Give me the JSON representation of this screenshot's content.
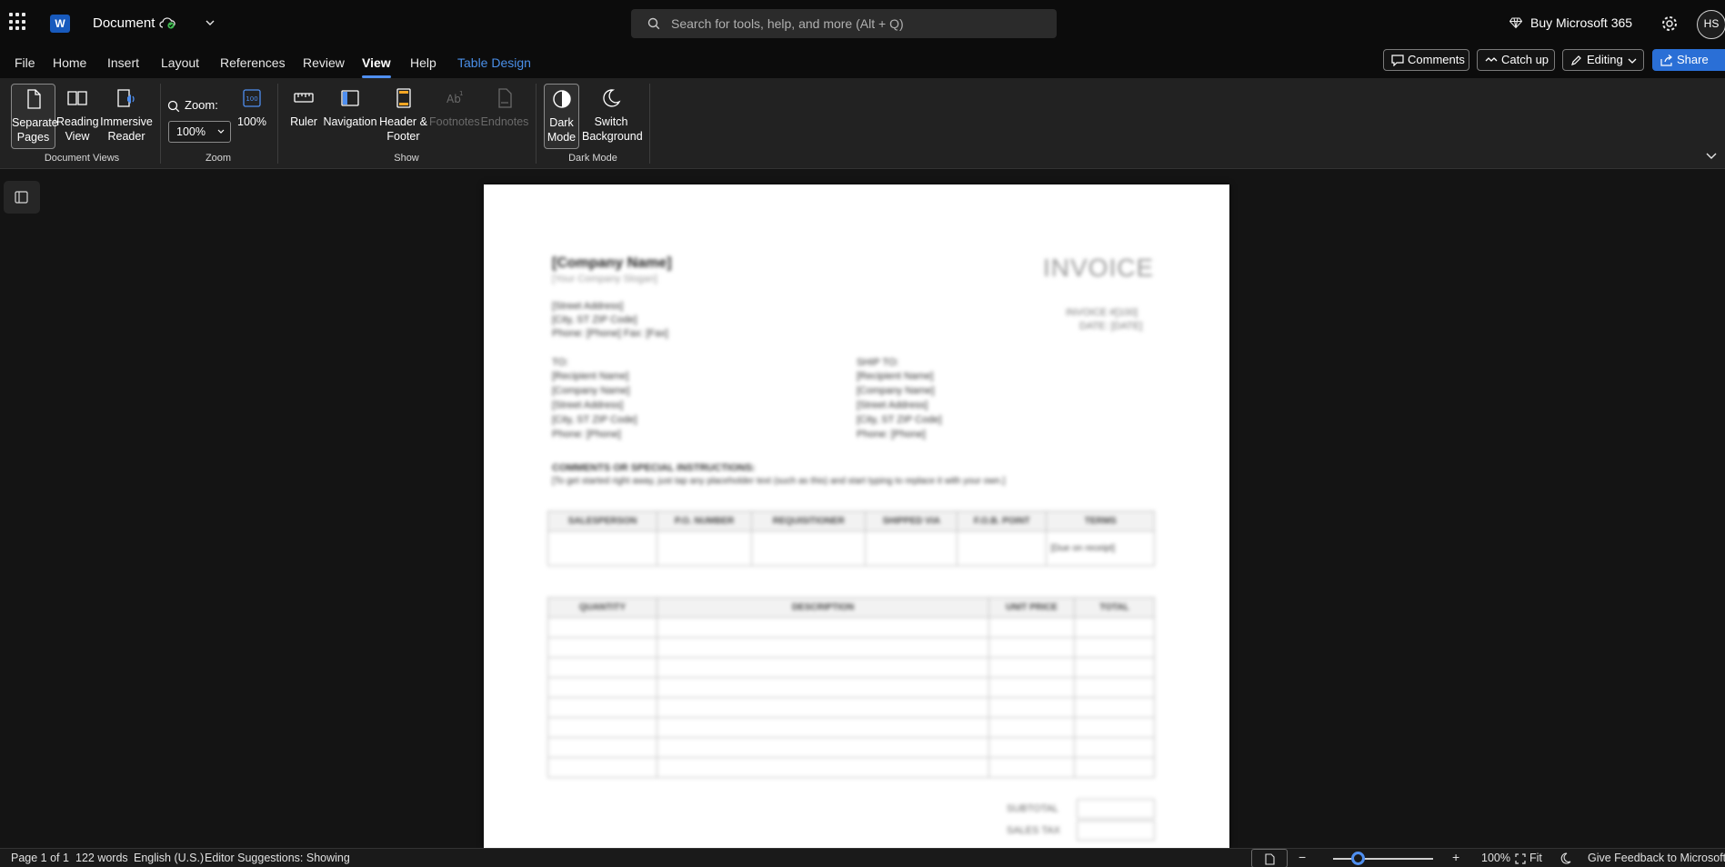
{
  "titlebar": {
    "doc_title": "Document",
    "search_placeholder": "Search for tools, help, and more (Alt + Q)",
    "buy_label": "Buy Microsoft 365",
    "avatar_initials": "HS",
    "app_letter": "W"
  },
  "tabs": {
    "file": "File",
    "home": "Home",
    "insert": "Insert",
    "layout": "Layout",
    "references": "References",
    "review": "Review",
    "view": "View",
    "help": "Help",
    "table_design": "Table Design"
  },
  "actions": {
    "comments": "Comments",
    "catch_up": "Catch up",
    "editing": "Editing",
    "share": "Share"
  },
  "ribbon": {
    "separate_pages": [
      "Separate",
      "Pages"
    ],
    "reading_view": [
      "Reading",
      "View"
    ],
    "immersive_reader": [
      "Immersive",
      "Reader"
    ],
    "document_views_label": "Document Views",
    "zoom_label": "Zoom:",
    "zoom_value": "100%",
    "zoom_100": "100%",
    "zoom_group_label": "Zoom",
    "ruler": "Ruler",
    "navigation": "Navigation",
    "header_footer": [
      "Header &",
      "Footer"
    ],
    "footnotes": "Footnotes",
    "endnotes": "Endnotes",
    "show_group_label": "Show",
    "dark_mode": [
      "Dark",
      "Mode"
    ],
    "switch_background": [
      "Switch",
      "Background"
    ],
    "dark_mode_group_label": "Dark Mode"
  },
  "document": {
    "company": "[Company Name]",
    "slogan": "[Your Company Slogan]",
    "address": [
      "[Street Address]",
      "[City, ST ZIP Code]",
      "Phone: [Phone]  Fax: [Fax]"
    ],
    "invoice_title": "INVOICE",
    "invoice_meta": [
      "INVOICE #[100]",
      "DATE: [DATE]"
    ],
    "to_block": [
      "TO:",
      "[Recipient Name]",
      "[Company Name]",
      "[Street Address]",
      "[City, ST ZIP Code]",
      "Phone: [Phone]"
    ],
    "ship_block": [
      "SHIP TO:",
      "[Recipient Name]",
      "[Company Name]",
      "[Street Address]",
      "[City, ST ZIP Code]",
      "Phone: [Phone]"
    ],
    "comments_heading": "COMMENTS OR SPECIAL INSTRUCTIONS:",
    "comments_text": "[To get started right away, just tap any placeholder text (such as this) and start typing to replace it with your own.]",
    "table1_headers": [
      "SALESPERSON",
      "P.O. NUMBER",
      "REQUISITIONER",
      "SHIPPED VIA",
      "F.O.B. POINT",
      "TERMS"
    ],
    "table1_terms": "[Due on receipt]",
    "table2_headers": [
      "QUANTITY",
      "DESCRIPTION",
      "UNIT PRICE",
      "TOTAL"
    ],
    "subtotal": "SUBTOTAL",
    "sales_tax": "SALES TAX"
  },
  "statusbar": {
    "page": "Page 1 of 1",
    "words": "122 words",
    "language": "English (U.S.)",
    "editor": "Editor Suggestions: Showing",
    "zoom": "100%",
    "fit": "Fit",
    "feedback": "Give Feedback to Microsoft",
    "zoom_level": 0.25
  }
}
